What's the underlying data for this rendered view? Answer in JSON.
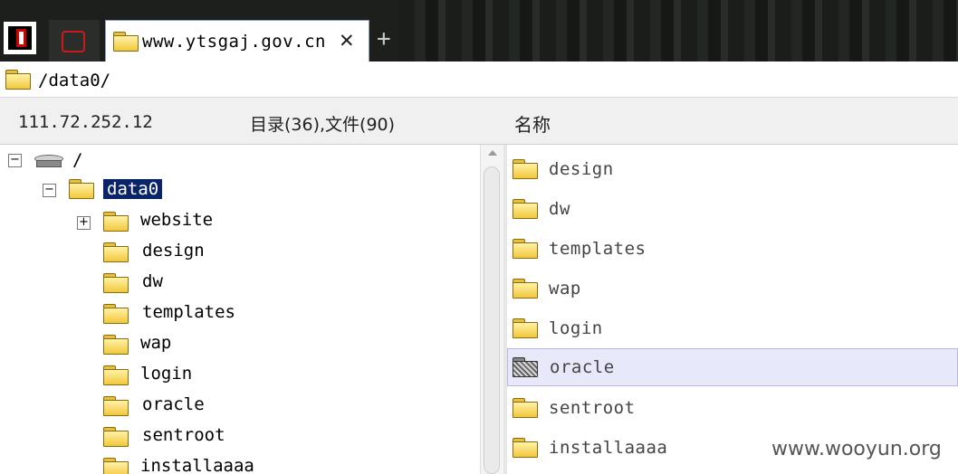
{
  "tabs": {
    "active_title": "www.ytsgaj.gov.cn"
  },
  "address": {
    "path": "/data0/"
  },
  "header": {
    "ip": "111.72.252.12",
    "counts": "目录(36),文件(90)",
    "name_column": "名称"
  },
  "tree": {
    "root_label": "/",
    "expanded_label": "data0",
    "items": [
      {
        "label": "website"
      },
      {
        "label": "design"
      },
      {
        "label": "dw"
      },
      {
        "label": "templates"
      },
      {
        "label": "wap"
      },
      {
        "label": "login"
      },
      {
        "label": "oracle"
      },
      {
        "label": "sentroot"
      },
      {
        "label": "installaaaa"
      }
    ]
  },
  "files": {
    "items": [
      {
        "name": "design"
      },
      {
        "name": "dw"
      },
      {
        "name": "templates"
      },
      {
        "name": "wap"
      },
      {
        "name": "login"
      },
      {
        "name": "oracle"
      },
      {
        "name": "sentroot"
      },
      {
        "name": "installaaaa"
      }
    ]
  },
  "watermark": "www.wooyun.org"
}
